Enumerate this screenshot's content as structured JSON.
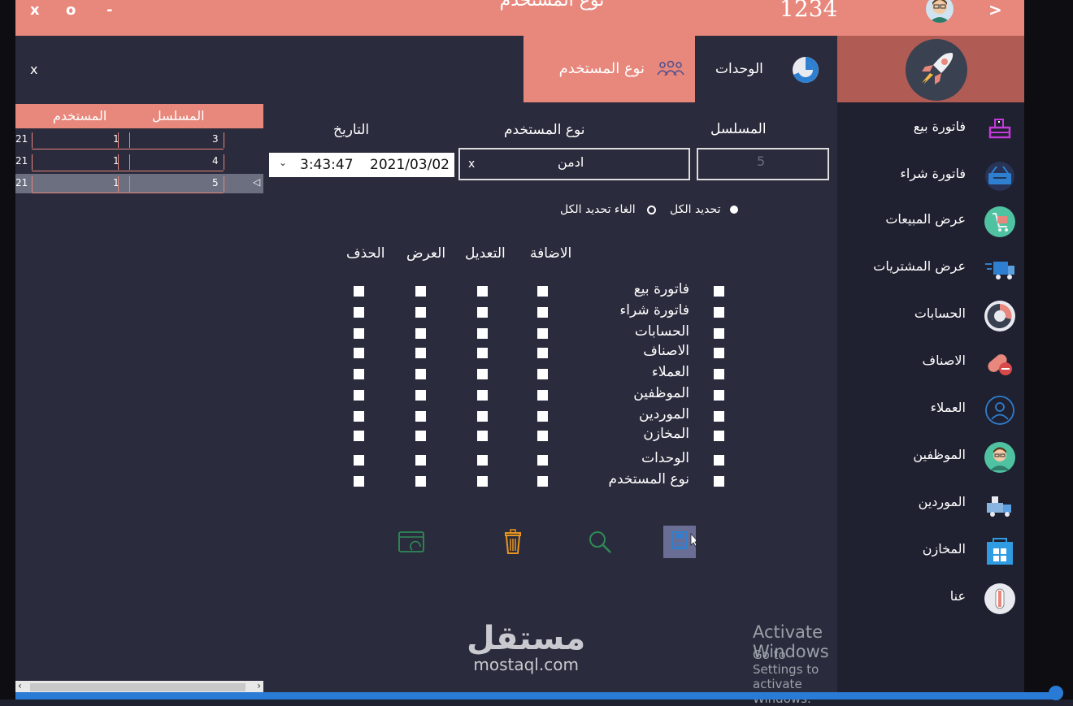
{
  "titlebar": {
    "close": "x",
    "restore": "o",
    "minimize": "-",
    "title": "نوع المستخدم",
    "user_code": "1234",
    "back": ">"
  },
  "tabs": {
    "close_label": "x",
    "active": "نوع المستخدم",
    "units": "الوحدات"
  },
  "sidebar": {
    "items": [
      {
        "label": "فاتورة بيع",
        "icon": "register-icon"
      },
      {
        "label": "فاتورة شراء",
        "icon": "basket-icon"
      },
      {
        "label": "عرض المبيعات",
        "icon": "cart-icon"
      },
      {
        "label": "عرض المشتريات",
        "icon": "truck-icon"
      },
      {
        "label": "الحسابات",
        "icon": "pie-chart-icon"
      },
      {
        "label": "الاصناف",
        "icon": "pills-icon"
      },
      {
        "label": "العملاء",
        "icon": "user-circle-icon"
      },
      {
        "label": "الموظفين",
        "icon": "employee-icon"
      },
      {
        "label": "الموردين",
        "icon": "delivery-truck-icon"
      },
      {
        "label": "المخازن",
        "icon": "store-icon"
      },
      {
        "label": "عنا",
        "icon": "info-icon"
      }
    ]
  },
  "grid": {
    "headers": {
      "serial": "المسلسل",
      "user": "المستخدم"
    },
    "rows": [
      {
        "serial": "3",
        "user": "1",
        "date": "21"
      },
      {
        "serial": "4",
        "user": "1",
        "date": "21"
      },
      {
        "serial": "5",
        "user": "1",
        "date": "21"
      }
    ],
    "selected_row": 2
  },
  "form": {
    "serial_label": "المسلسل",
    "serial_value": "5",
    "usertype_label": "نوع المستخدم",
    "usertype_value": "ادمن",
    "usertype_clear": "x",
    "date_label": "التاريخ",
    "date_value": "2021/03/02",
    "time_value": "3:43:47",
    "select_all": "تحديد الكل",
    "deselect_all": "الغاء تحديد الكل",
    "columns": {
      "add": "الاضافة",
      "edit": "التعديل",
      "view": "العرض",
      "delete": "الحذف"
    },
    "permissions": [
      "فاتورة بيع",
      "فاتورة شراء",
      "الحسابات",
      "الاصناف",
      "العملاء",
      "الموظفين",
      "الموردين",
      "المخازن",
      "الوحدات",
      "نوع المستخدم"
    ]
  },
  "actions": {
    "save": "save-icon",
    "search": "search-icon",
    "delete": "trash-icon",
    "refresh": "wallet-refresh-icon"
  },
  "watermark": {
    "arabic": "مستقل",
    "latin": "mostaql.com"
  },
  "activation": {
    "title": "Activate Windows",
    "subtitle": "Go to Settings to activate Windows."
  },
  "colors": {
    "accent": "#e8877c",
    "panel": "#2a2b3c",
    "background": "#1f2030",
    "logo_bg": "#b05c55",
    "taskbar": "#2a7bd6"
  }
}
